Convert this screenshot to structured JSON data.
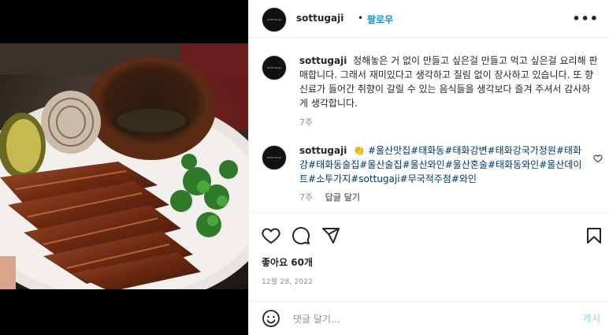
{
  "post": {
    "author": "sottugaji",
    "avatar_text": "SOTTUGAJI",
    "follow_label": "팔로우",
    "dot": "•",
    "more_label": "•••"
  },
  "caption": {
    "username": "sottugaji",
    "text": "정해놓은 거 없이 만들고 싶은걸 만들고 먹고 싶은걸 요리해 판매합니다. 그래서 재미있다고 생각하고 질림 없이 장사하고 있습니다. 또 향신료가 들어간 취향이 갈릴 수 있는 음식들을 생각보다 즐겨 주셔서 감사하게 생각합니다.",
    "time": "7주"
  },
  "comment": {
    "username": "sottugaji",
    "emoji": "👏",
    "hashtags": "#울산맛집#태화동#태화강변#태화강국가정원#태화강#태화동술집#울산술집#울산와인#울산혼술#태화동와인#울산데이트#소투가지#sottugaji#무국적주점#와인",
    "time": "7주",
    "reply_label": "답글 달기"
  },
  "actions": {
    "likes": "좋아요 60개",
    "date": "12월 28, 2022"
  },
  "add_comment": {
    "placeholder": "댓글 달기...",
    "post_label": "게시"
  },
  "icons": {
    "like": "heart-icon",
    "comment": "comment-icon",
    "share": "share-icon",
    "save": "bookmark-icon",
    "emoji": "emoji-icon",
    "more": "more-icon"
  }
}
